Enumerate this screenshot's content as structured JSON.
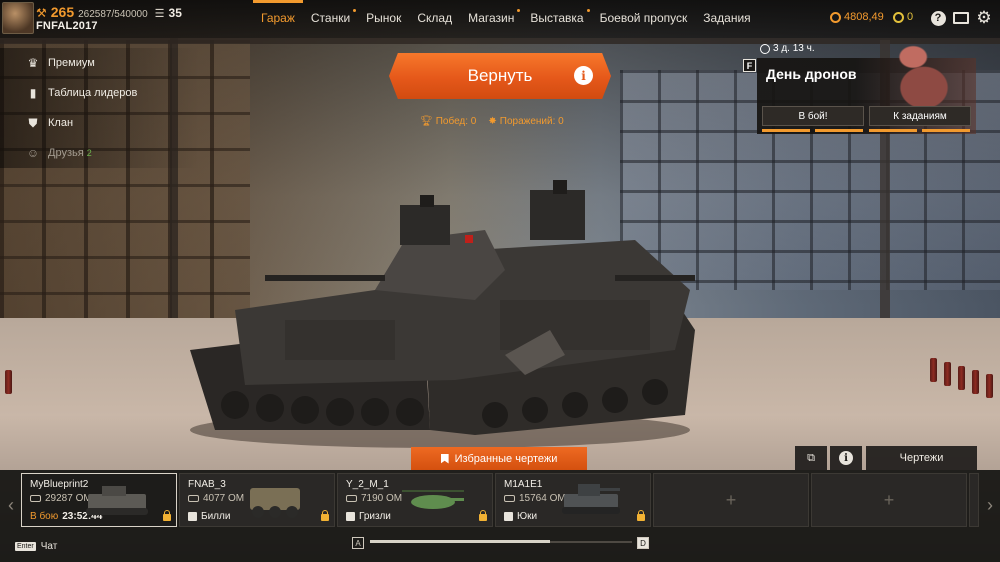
{
  "player": {
    "level": "265",
    "xp": "262587/540000",
    "reputation": "35",
    "nickname": "FNFAL2017"
  },
  "nav": {
    "items": [
      {
        "label": "Гараж",
        "active": true,
        "dot": false
      },
      {
        "label": "Станки",
        "active": false,
        "dot": true
      },
      {
        "label": "Рынок",
        "active": false,
        "dot": false
      },
      {
        "label": "Склад",
        "active": false,
        "dot": false
      },
      {
        "label": "Магазин",
        "active": false,
        "dot": true
      },
      {
        "label": "Выставка",
        "active": false,
        "dot": true
      },
      {
        "label": "Боевой пропуск",
        "active": false,
        "dot": false
      },
      {
        "label": "Задания",
        "active": false,
        "dot": false
      }
    ]
  },
  "currency": {
    "coins": "4808,49",
    "badges": "0"
  },
  "side_menu": {
    "premium": "Премиум",
    "leaderboard": "Таблица лидеров",
    "clan": "Клан",
    "friends": "Друзья",
    "friends_count": "2"
  },
  "center": {
    "return_label": "Вернуть",
    "wins_label": "Побед: 0",
    "losses_label": "Поражений: 0"
  },
  "event": {
    "timer": "3 д. 13 ч.",
    "badge": "F",
    "title": "День дронов",
    "battle_button": "В бой!",
    "tasks_button": "К заданиям"
  },
  "bottom": {
    "favorites_label": "Избранные чертежи",
    "blueprints_label": "Чертежи",
    "chat_label": "Чат",
    "enter_key": "Enter",
    "key_left": "A",
    "key_right": "D",
    "empty_slot_symbol": "+"
  },
  "cars": [
    {
      "name": "MyBlueprint2",
      "om": "29287 ОМ",
      "status": "В бою",
      "timer": "23:52:44",
      "faction": "",
      "selected": true,
      "color": "#5c5a55"
    },
    {
      "name": "FNAB_3",
      "om": "4077 ОМ",
      "status": "",
      "timer": "",
      "faction": "Билли",
      "selected": false,
      "color": "#7a6f55"
    },
    {
      "name": "Y_2_M_1",
      "om": "7190 ОМ",
      "status": "",
      "timer": "",
      "faction": "Гризли",
      "selected": false,
      "color": "#5f8d4e"
    },
    {
      "name": "M1A1E1",
      "om": "15764 ОМ",
      "status": "",
      "timer": "",
      "faction": "Юки",
      "selected": false,
      "color": "#4f5254"
    }
  ],
  "colors": {
    "accent": "#f29a2e",
    "button_orange": "#e5581a",
    "lock": "#f2b233"
  }
}
